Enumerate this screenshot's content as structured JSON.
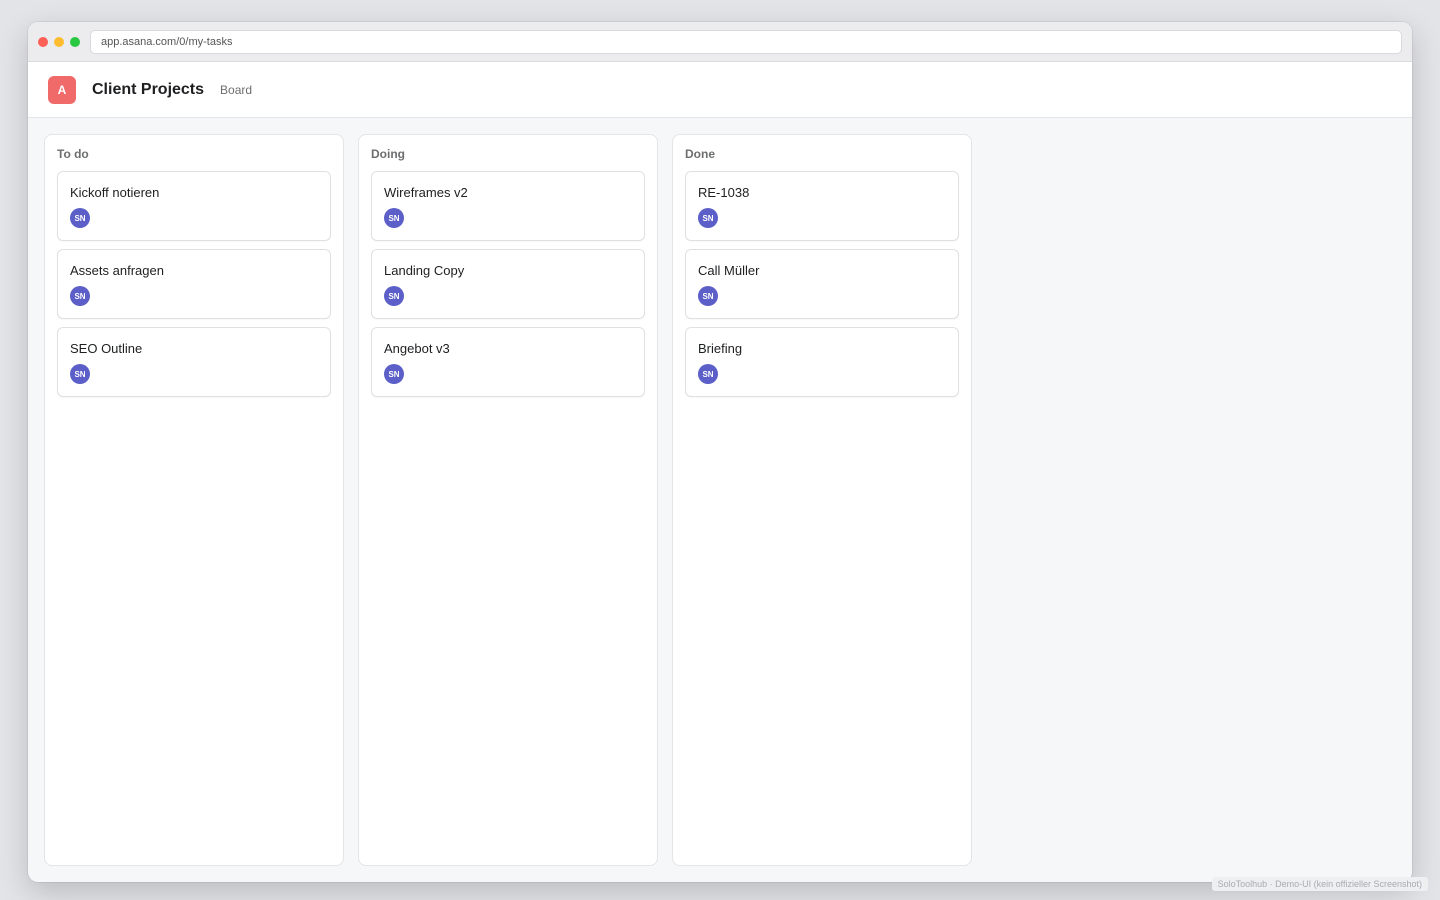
{
  "browser": {
    "url": "app.asana.com/0/my-tasks"
  },
  "header": {
    "logo_letter": "A",
    "title": "Client Projects",
    "view_tab": "Board"
  },
  "columns": [
    {
      "title": "To do",
      "cards": [
        {
          "title": "Kickoff notieren",
          "assignee": "SN"
        },
        {
          "title": "Assets anfragen",
          "assignee": "SN"
        },
        {
          "title": "SEO Outline",
          "assignee": "SN"
        }
      ]
    },
    {
      "title": "Doing",
      "cards": [
        {
          "title": "Wireframes v2",
          "assignee": "SN"
        },
        {
          "title": "Landing Copy",
          "assignee": "SN"
        },
        {
          "title": "Angebot v3",
          "assignee": "SN"
        }
      ]
    },
    {
      "title": "Done",
      "cards": [
        {
          "title": "RE-1038",
          "assignee": "SN"
        },
        {
          "title": "Call Müller",
          "assignee": "SN"
        },
        {
          "title": "Briefing",
          "assignee": "SN"
        }
      ]
    }
  ],
  "footer_note": "SoloToolhub · Demo-UI (kein offizieller Screenshot)",
  "colors": {
    "logo": "#f06a6a",
    "avatar": "#5b5fc7"
  }
}
